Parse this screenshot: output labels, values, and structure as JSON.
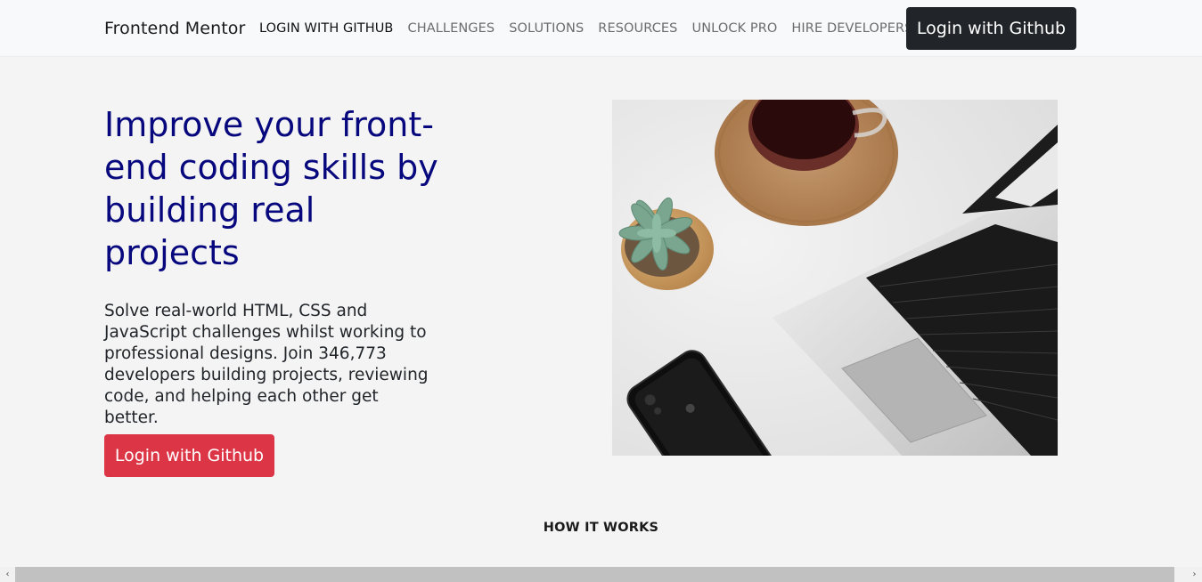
{
  "navbar": {
    "brand": "Frontend Mentor",
    "links": [
      {
        "label": "LOGIN WITH GITHUB"
      },
      {
        "label": "CHALLENGES"
      },
      {
        "label": "SOLUTIONS"
      },
      {
        "label": "RESOURCES"
      },
      {
        "label": "UNLOCK PRO"
      },
      {
        "label": "HIRE DEVELOPERS"
      }
    ],
    "login_button": "Login with Github"
  },
  "hero": {
    "title": "Improve your front-end coding skills by building real projects",
    "description": "Solve real-world HTML, CSS and JavaScript challenges whilst working to professional designs. Join 346,773 developers building projects, reviewing code, and helping each other get better.",
    "login_button": "Login with Github",
    "image_icon": "workspace-photo"
  },
  "section": {
    "how_it_works": "HOW IT WORKS"
  },
  "scrollbar": {
    "left_arrow": "‹",
    "right_arrow": "›"
  },
  "colors": {
    "title": "#08087e",
    "dark_button": "#212529",
    "red_button": "#dc3545",
    "background": "#f4f4f4",
    "navbar": "#f8f9fa"
  }
}
